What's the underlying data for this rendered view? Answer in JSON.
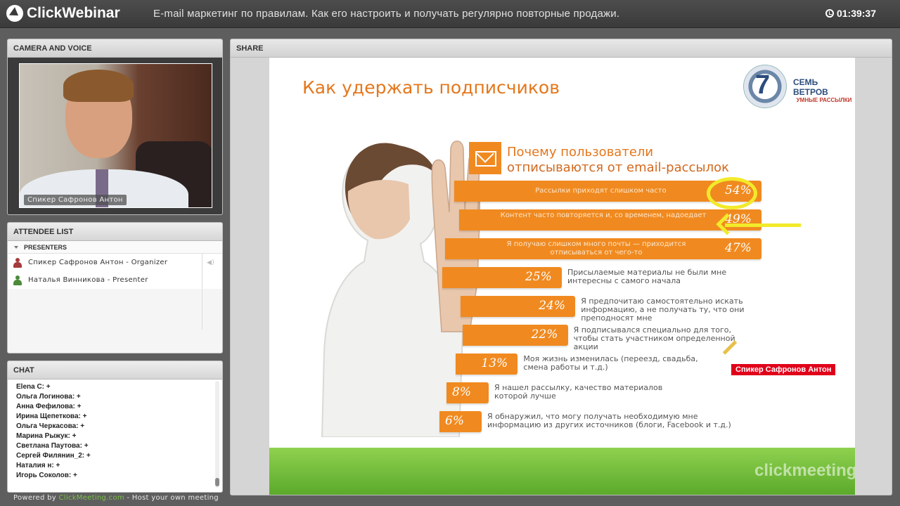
{
  "app": {
    "brand": "ClickWebinar",
    "title": "E-mail маркетинг по правилам. Как его настроить и получать регулярно повторные продажи.",
    "timer": "01:39:37"
  },
  "camera": {
    "header": "CAMERA AND VOICE",
    "caption": "Спикер  Сафронов Антон"
  },
  "attendees": {
    "header": "ATTENDEE LIST",
    "group": "PRESENTERS",
    "people": [
      {
        "name": "Спикер  Сафронов Антон - Organizer",
        "role_color": "red"
      },
      {
        "name": "Наталья Винникова - Presenter",
        "role_color": "green"
      }
    ]
  },
  "chat": {
    "header": "CHAT",
    "lines": [
      "Elena C: +",
      "Ольга Логинова: +",
      "Анна Фефилова: +",
      "Ирина Щепеткова: +",
      "Ольга Черкасова: +",
      "Марина Рыжук: +",
      "Светлана Паутова: +",
      "Сергей Филянин_2: +",
      "Наталия н: +",
      "Игорь Соколов: +"
    ]
  },
  "footer": {
    "prefix": "Powered by ",
    "link": "ClickMeeting.com",
    "suffix": " - Host your own meeting"
  },
  "share": {
    "header": "SHARE",
    "slide_title": "Как удержать подписчиков",
    "brand_number": "7",
    "brand_name": "СЕМЬ ВЕТРОВ",
    "brand_tagline": "УМНЫЕ РАССЫЛКИ",
    "question_line1": "Почему пользователи",
    "question_line2": "отписываются от email-рассылок",
    "speaker_tag": "Спикер  Сафронов Антон",
    "watermark": "clickmeeting",
    "colors": {
      "accent": "#f08a20",
      "highlight": "#f2ea2a",
      "tag": "#e0001a"
    }
  },
  "chart_data": {
    "type": "bar",
    "title": "Почему пользователи отписываются от email-рассылок",
    "categories": [
      "Рассылки приходят слишком часто",
      "Контент часто повторяется и, со временем, надоедает",
      "Я получаю слишком много почты — приходится отписываться от чего-то",
      "Присылаемые материалы не были мне интересны с самого начала",
      "Я предпочитаю самостоятельно искать информацию, а не получать ту, что они преподносят мне",
      "Я подписывался специально для того, чтобы стать участником определенной акции",
      "Моя жизнь изменилась (переезд, свадьба, смена работы и т.д.)",
      "Я нашел рассылку, качество материалов которой лучше",
      "Я обнаружил, что могу получать необходимую мне информацию из других источников (блоги, Facebook и т.д.)"
    ],
    "labels": [
      "54%",
      "49%",
      "47%",
      "25%",
      "24%",
      "22%",
      "13%",
      "8%",
      "6%"
    ],
    "values": [
      54,
      49,
      47,
      25,
      24,
      22,
      13,
      8,
      6
    ]
  }
}
